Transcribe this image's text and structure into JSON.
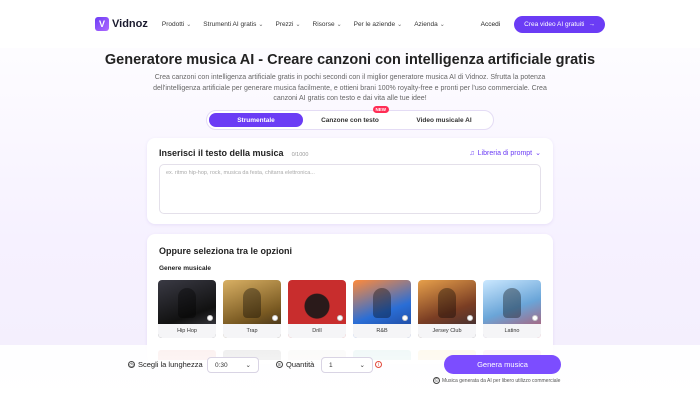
{
  "colors": {
    "accent": "#6b3cf5",
    "new_badge": "#ff2d55",
    "info": "#e24a3b"
  },
  "nav": {
    "logo_text": "Vidnoz",
    "items": [
      {
        "label": "Prodotti"
      },
      {
        "label": "Strumenti AI gratis"
      },
      {
        "label": "Prezzi"
      },
      {
        "label": "Risorse"
      },
      {
        "label": "Per le aziende"
      },
      {
        "label": "Azienda"
      }
    ],
    "login_label": "Accedi",
    "cta_label": "Crea video AI gratuiti",
    "cta_icon": "arrow-right-icon"
  },
  "hero": {
    "title": "Generatore musica AI - Creare canzoni con intelligenza artificiale gratis",
    "subtitle": "Crea canzoni con intelligenza artificiale gratis in pochi secondi con il miglior generatore musica AI di Vidnoz. Sfrutta la potenza dell'intelligenza artificiale per generare musica facilmente, e ottieni brani 100% royalty-free e pronti per l'uso commerciale. Crea canzoni AI gratis con testo e dai vita alle tue idee!"
  },
  "tabs": [
    {
      "label": "Strumentale",
      "active": true
    },
    {
      "label": "Canzone con testo",
      "badge": "NEW"
    },
    {
      "label": "Video musicale AI"
    }
  ],
  "prompt": {
    "title": "Inserisci il testo della musica",
    "counter": "0/1000",
    "library_label": "Libreria di prompt",
    "library_icon": "music-note-icon",
    "placeholder": "ex. ritmo hip-hop, rock, musica da festa, chitarra elettronica..."
  },
  "options": {
    "title": "Oppure seleziona tra le opzioni",
    "genre_label": "Genere musicale",
    "genres": [
      {
        "label": "Hip Hop"
      },
      {
        "label": "Trap"
      },
      {
        "label": "Drill"
      },
      {
        "label": "R&B"
      },
      {
        "label": "Jersey Club"
      },
      {
        "label": "Latino"
      }
    ]
  },
  "bottom": {
    "length_label": "Scegli la lunghezza",
    "length_value": "0:30",
    "quantity_label": "Quantità",
    "quantity_value": "1",
    "generate_label": "Genera musica",
    "note": "Musica generata da AI per libero utilizzo commerciale"
  }
}
